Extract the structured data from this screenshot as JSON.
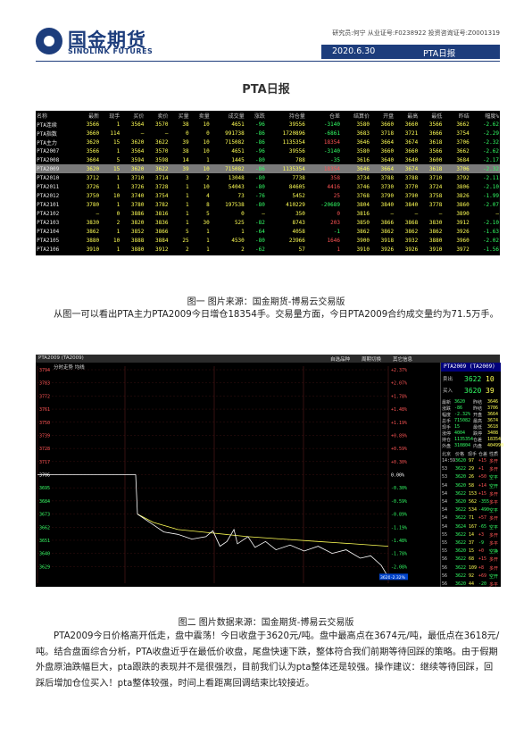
{
  "header": {
    "logo_name": "国金期货",
    "logo_en": "SINOLINK FUTURES",
    "cert": "研究员:何宁  从业证号:F0238922  投资咨询证号:Z0001319",
    "date": "2020.6.30",
    "report": "PTA日报"
  },
  "doc_title": "PTA日报",
  "colors": {
    "brand": "#1d3d7c",
    "up": "#ff5555",
    "down": "#33ff66",
    "price": "#ffff55"
  },
  "quote_table": {
    "columns": [
      "名称",
      "最新",
      "现手",
      "买价",
      "卖价",
      "买量",
      "卖量",
      "成交量",
      "涨跌",
      "持仓量",
      "仓差",
      "结算价",
      "开盘",
      "最高",
      "最低",
      "",
      "昨结",
      "幅度%"
    ],
    "rows": [
      [
        "PTA连续",
        "3566",
        "1",
        "3564",
        "3570",
        "38",
        "10",
        "4651",
        "-96",
        "39556",
        "-3140",
        "3580",
        "3660",
        "3660",
        "3566",
        "",
        "3662",
        "-2.62"
      ],
      [
        "PTA指数",
        "3660",
        "114",
        "—",
        "—",
        "0",
        "0",
        "991738",
        "-86",
        "1720896",
        "-6861",
        "3683",
        "3718",
        "3721",
        "3666",
        "",
        "3754",
        "-2.29"
      ],
      [
        "PTA主力",
        "3620",
        "15",
        "3620",
        "3622",
        "39",
        "10",
        "715082",
        "-86",
        "1135354",
        "18354",
        "3646",
        "3664",
        "3674",
        "3618",
        "",
        "3706",
        "-2.32"
      ],
      [
        "PTA2007",
        "3566",
        "1",
        "3564",
        "3570",
        "38",
        "10",
        "4651",
        "-96",
        "39556",
        "-3140",
        "3580",
        "3660",
        "3660",
        "3566",
        "",
        "3662",
        "-2.62"
      ],
      [
        "PTA2008",
        "3604",
        "5",
        "3594",
        "3598",
        "14",
        "1",
        "1445",
        "-80",
        "788",
        "-35",
        "3616",
        "3640",
        "3640",
        "3600",
        "",
        "3684",
        "-2.17"
      ],
      [
        "PTA2009",
        "3620",
        "15",
        "3620",
        "3622",
        "39",
        "10",
        "715082",
        "-86",
        "1135354",
        "18354",
        "3646",
        "3664",
        "3674",
        "3618",
        "",
        "3706",
        "-2.32"
      ],
      [
        "PTA2010",
        "3712",
        "1",
        "3710",
        "3714",
        "3",
        "2",
        "13048",
        "-80",
        "7738",
        "358",
        "3734",
        "3788",
        "3788",
        "3710",
        "",
        "3792",
        "-2.11"
      ],
      [
        "PTA2011",
        "3726",
        "1",
        "3726",
        "3728",
        "1",
        "10",
        "54043",
        "-80",
        "84605",
        "4416",
        "3746",
        "3730",
        "3770",
        "3724",
        "",
        "3806",
        "-2.10"
      ],
      [
        "PTA2012",
        "3750",
        "10",
        "3740",
        "3754",
        "1",
        "4",
        "73",
        "-76",
        "5452",
        "25",
        "3768",
        "3790",
        "3790",
        "3758",
        "",
        "3826",
        "-1.99"
      ],
      [
        "PTA2101",
        "3780",
        "1",
        "3780",
        "3782",
        "1",
        "8",
        "197538",
        "-80",
        "410229",
        "-20689",
        "3804",
        "3840",
        "3840",
        "3778",
        "",
        "3860",
        "-2.07"
      ],
      [
        "PTA2102",
        "—",
        "0",
        "3886",
        "3816",
        "1",
        "5",
        "0",
        "—",
        "350",
        "0",
        "3816",
        "—",
        "—",
        "—",
        "",
        "3890",
        "—"
      ],
      [
        "PTA2103",
        "3830",
        "2",
        "3820",
        "3836",
        "1",
        "30",
        "525",
        "-82",
        "8743",
        "203",
        "3850",
        "3866",
        "3868",
        "3830",
        "",
        "3912",
        "-2.10"
      ],
      [
        "PTA2104",
        "3862",
        "1",
        "3852",
        "3866",
        "5",
        "1",
        "1",
        "-64",
        "4058",
        "-1",
        "3862",
        "3862",
        "3862",
        "3862",
        "",
        "3926",
        "-1.63"
      ],
      [
        "PTA2105",
        "3880",
        "10",
        "3888",
        "3884",
        "25",
        "1",
        "4530",
        "-80",
        "23966",
        "1646",
        "3900",
        "3918",
        "3932",
        "3880",
        "",
        "3960",
        "-2.02"
      ],
      [
        "PTA2106",
        "3910",
        "1",
        "3880",
        "3912",
        "2",
        "1",
        "2",
        "-62",
        "57",
        "1",
        "3910",
        "3926",
        "3926",
        "3910",
        "",
        "3972",
        "-1.56"
      ]
    ]
  },
  "caption1": "图一   图片来源：国金期货-博易云交易版",
  "para1": "从图一可以看出PTA主力PTA2009今日增仓18354手。交易量方面，今日PTA2009合约成交量约为71.5万手。",
  "chart": {
    "topbar": [
      "PTA2009 (TA2009)",
      "分时走势",
      "均线",
      "自选品种",
      "周期切换",
      "其它信息"
    ],
    "y_ticks": [
      "3794",
      "3783",
      "3772",
      "3761",
      "3750",
      "3739",
      "3728",
      "3717",
      "3706",
      "3695",
      "3684",
      "3673",
      "3662",
      "3651",
      "3640",
      "3629"
    ],
    "pct_ticks": [
      "+2.37%",
      "+2.07%",
      "+1.78%",
      "+1.48%",
      "+1.19%",
      "+0.89%",
      "+0.59%",
      "+0.30%",
      "0.00%",
      "-0.30%",
      "-0.59%",
      "-0.89%",
      "-1.19%",
      "-1.48%",
      "-1.78%",
      "-2.08%"
    ],
    "current_price_tag": "3620",
    "current_pct_tag": "-2.32%",
    "panel_title": "PTA2009 (TA2009)",
    "sell": {
      "label": "卖出",
      "price": "3622",
      "vol": "10"
    },
    "buy": {
      "label": "买入",
      "price": "3620",
      "vol": "39"
    },
    "stats": [
      [
        "最新",
        "3620",
        "昨结",
        "3646"
      ],
      [
        "涨跌",
        "-86",
        "昨结",
        "3706"
      ],
      [
        "幅度",
        "-2.32%",
        "开盘",
        "3664"
      ],
      [
        "总手",
        "715082",
        "最高",
        "3674"
      ],
      [
        "现手",
        "15",
        "最低",
        "3618"
      ],
      [
        "涨停",
        "4004",
        "跌停",
        "3408"
      ],
      [
        "持仓",
        "1135354",
        "仓差",
        "18354"
      ],
      [
        "外盘",
        "310804",
        "内盘",
        "404990"
      ]
    ],
    "ticks_header": [
      "北京",
      "价格",
      "现手",
      "仓差",
      "性质"
    ],
    "ticks": [
      [
        "14:59",
        "3620",
        "97",
        "+15",
        "多开"
      ],
      [
        "53",
        "3622",
        "29",
        "+1",
        "多开"
      ],
      [
        "53",
        "3620",
        "26",
        "+50",
        "空平"
      ],
      [
        "54",
        "3620",
        "58",
        "+14",
        "空开"
      ],
      [
        "54",
        "3622",
        "153",
        "+15",
        "多开"
      ],
      [
        "54",
        "3620",
        "562",
        "-355",
        "多平"
      ],
      [
        "54",
        "3622",
        "534",
        "-490",
        "空平"
      ],
      [
        "54",
        "3622",
        "71",
        "+57",
        "多开"
      ],
      [
        "54",
        "3624",
        "167",
        "-65",
        "空平"
      ],
      [
        "55",
        "3622",
        "14",
        "+3",
        "多开"
      ],
      [
        "55",
        "3622",
        "37",
        "-9",
        "多平"
      ],
      [
        "55",
        "3620",
        "15",
        "+0",
        "空换"
      ],
      [
        "56",
        "3622",
        "68",
        "+15",
        "多开"
      ],
      [
        "56",
        "3622",
        "109",
        "+8",
        "多开"
      ],
      [
        "56",
        "3622",
        "92",
        "+69",
        "空开"
      ],
      [
        "56",
        "3620",
        "44",
        "-20",
        "多平"
      ]
    ]
  },
  "caption2": "图二   图片数据来源：国金期货-博易云交易版",
  "para2": "PTA2009今日价格高开低走，盘中震荡！今日收盘于3620元/吨。盘中最高点在3674元/吨，最低点在3618元/吨。结合盘面综合分析，PTA收盘近乎在最低价收盘，尾盘快速下跌，整体符合我们前期等待回踩的策略。由于假期外盘原油跌幅巨大，pta跟跌的表现并不是很强烈，目前我们认为pta整体还是较强。操作建议：继续等待回踩，回踩后增加仓位买入！pta整体较强，时间上看距离回调结束比较接近。"
}
